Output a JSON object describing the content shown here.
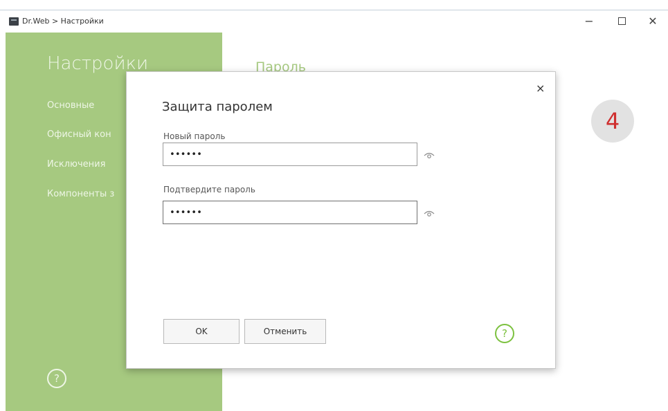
{
  "window": {
    "title": "Dr.Web > Настройки",
    "minimize_glyph": "−",
    "close_glyph": "✕"
  },
  "sidebar": {
    "title": "Настройки",
    "items": [
      {
        "label": "Основные"
      },
      {
        "label": "Офисный кон"
      },
      {
        "label": "Исключения"
      },
      {
        "label": "Компоненты з"
      }
    ],
    "help_glyph": "?"
  },
  "content": {
    "title": "Пароль",
    "badge": "4"
  },
  "dialog": {
    "close_glyph": "×",
    "title": "Защита паролем",
    "new_password_label": "Новый пароль",
    "new_password_value": "••••••",
    "confirm_password_label": "Подтвердите пароль",
    "confirm_password_value": "••••••",
    "ok_label": "OK",
    "cancel_label": "Отменить",
    "help_glyph": "?"
  },
  "colors": {
    "sidebar": "#a6c980",
    "accent_green": "#7cc13f",
    "badge_number": "#cf2f2f"
  },
  "icons": [
    "app-icon",
    "minimize-icon",
    "maximize-icon",
    "close-icon",
    "show-password-icon",
    "help-icon"
  ]
}
